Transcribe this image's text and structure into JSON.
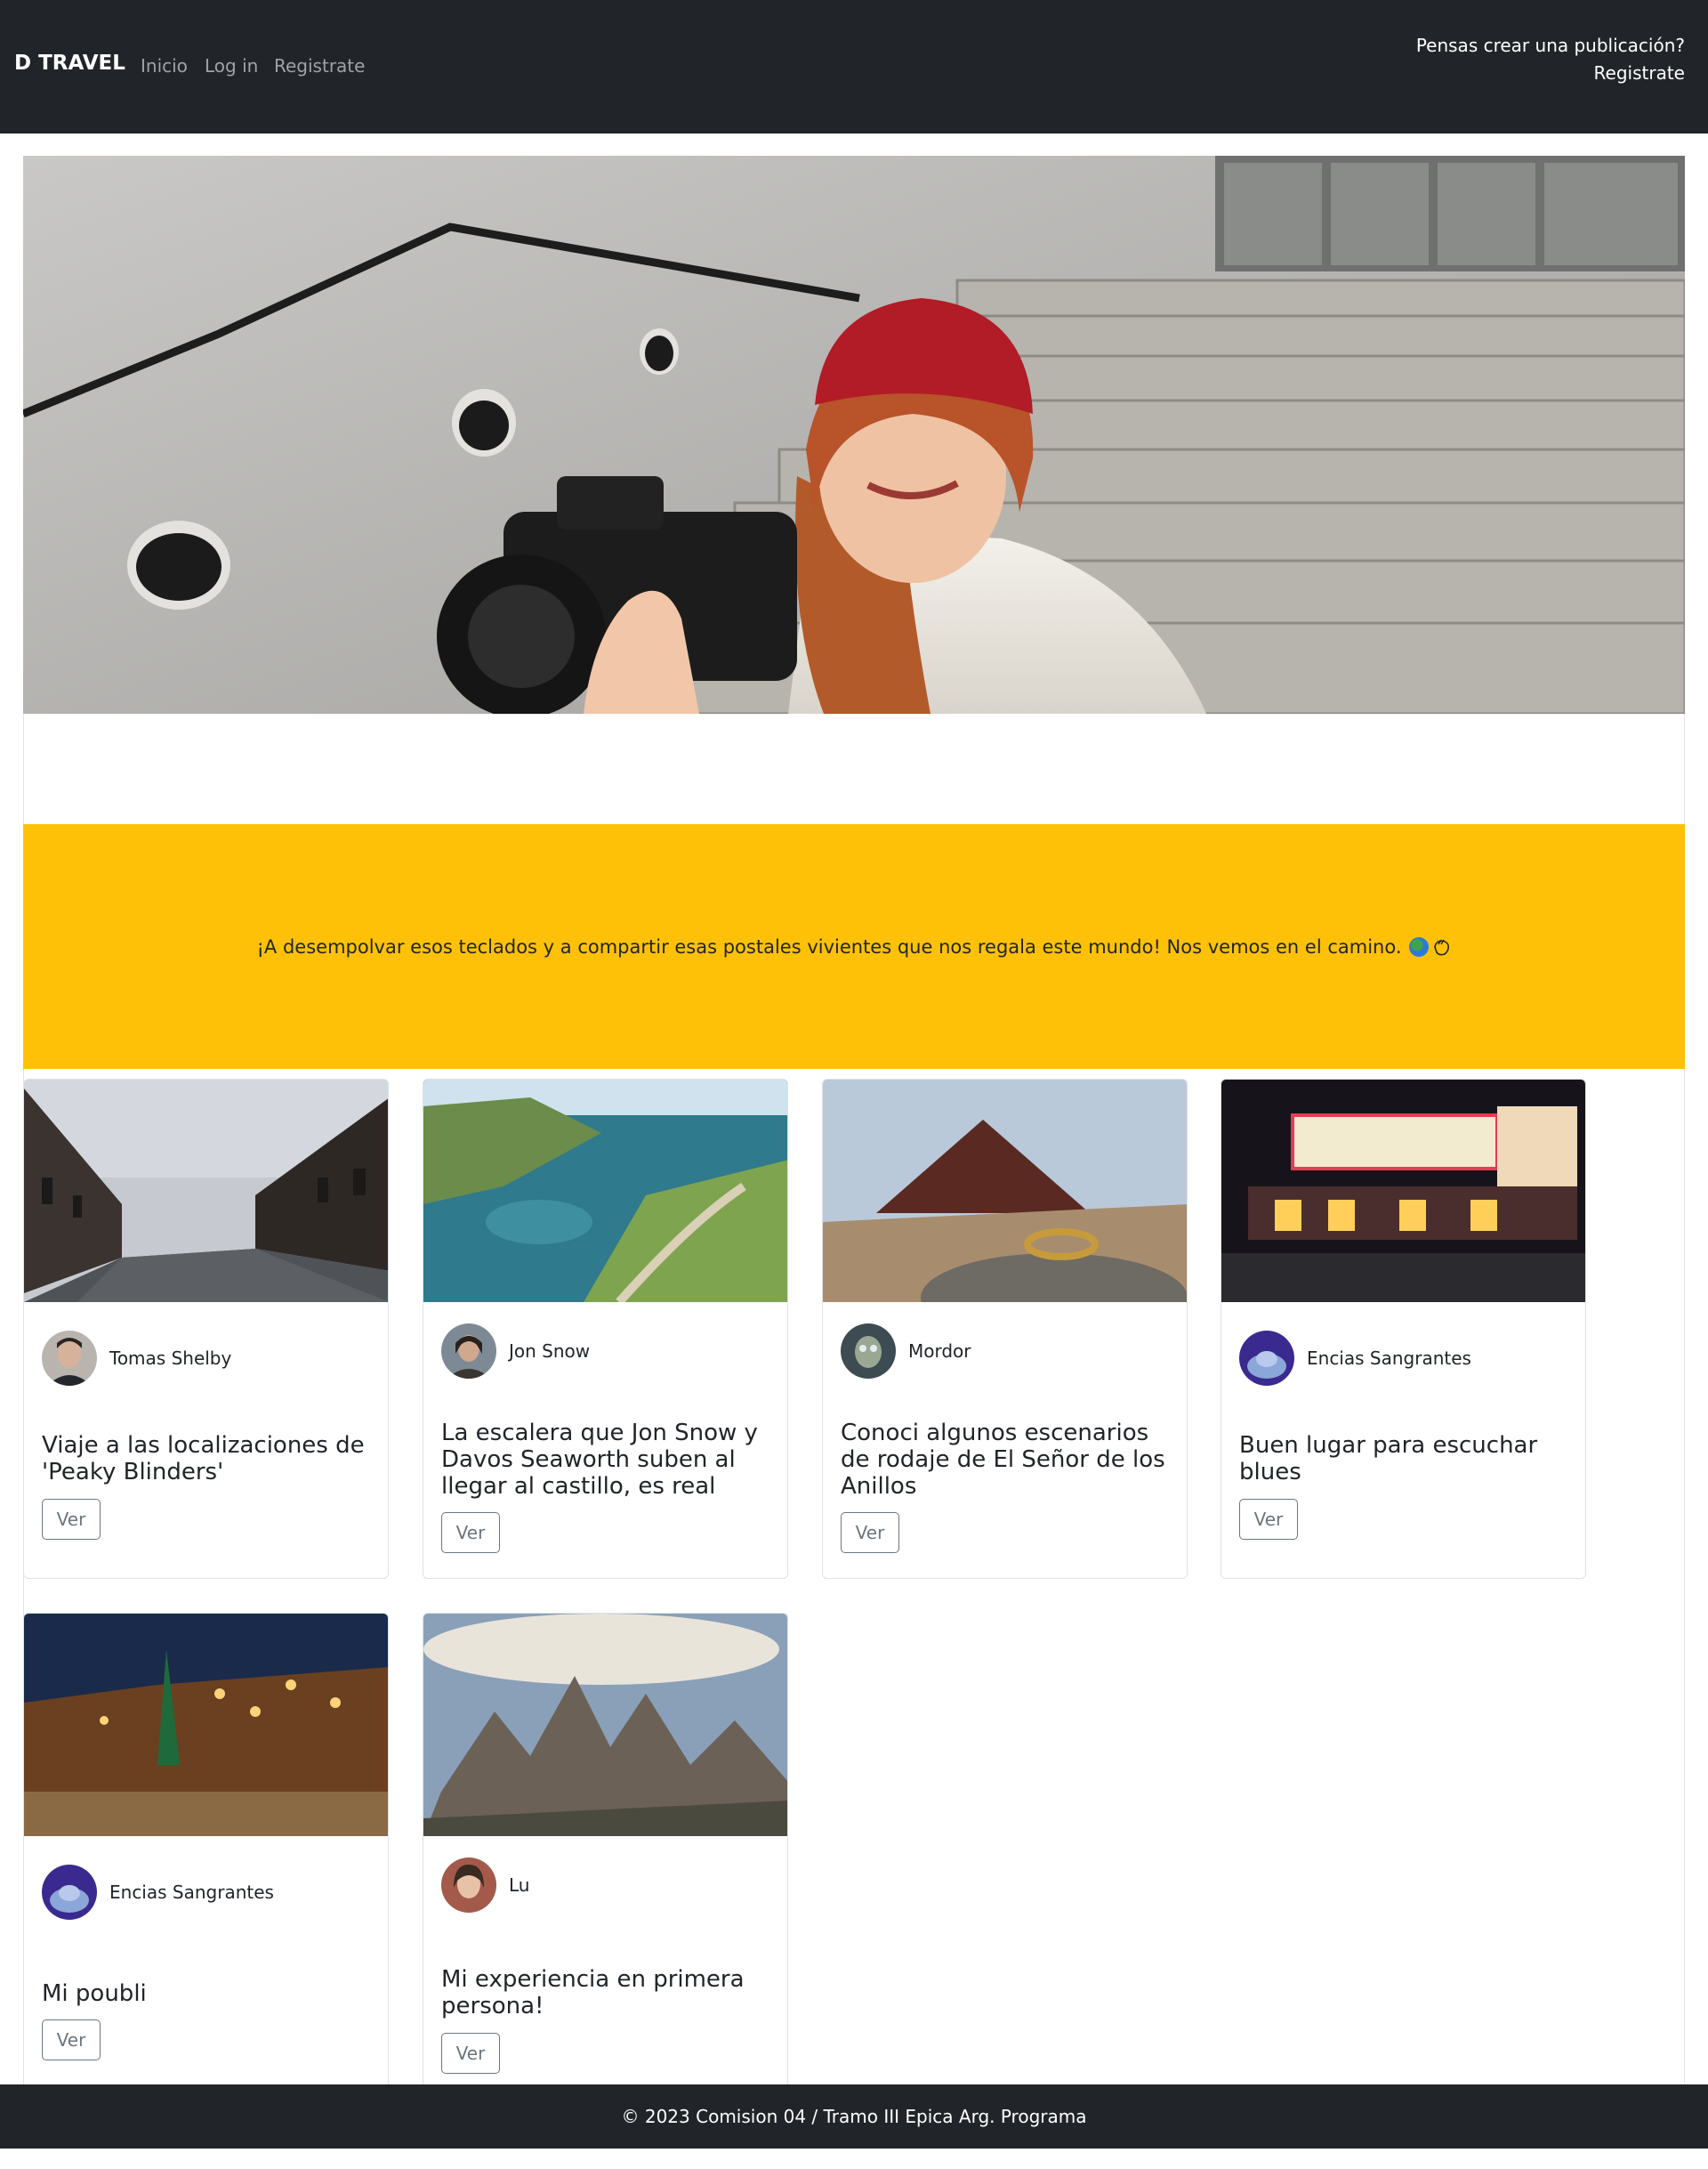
{
  "nav": {
    "brand": "D TRAVEL",
    "links": [
      "Inicio",
      "Log in",
      "Registrate"
    ],
    "cta_question": "Pensas crear una publicación?",
    "cta_link": "Registrate"
  },
  "banner": {
    "text": "¡A desempolvar esos teclados y a compartir esas postales vivientes que nos regala este mundo! Nos vemos en el camino.",
    "icons": [
      "globe-icon",
      "waving-hand-icon"
    ]
  },
  "posts": [
    {
      "author": "Tomas Shelby",
      "title": "Viaje a las localizaciones de 'Peaky Blinders'",
      "button": "Ver"
    },
    {
      "author": "Jon Snow",
      "title": "La escalera que Jon Snow y Davos Seaworth suben al llegar al castillo, es real",
      "button": "Ver"
    },
    {
      "author": "Mordor",
      "title": "Conoci algunos escenarios de rodaje de El Señor de los Anillos",
      "button": "Ver"
    },
    {
      "author": "Encias Sangrantes",
      "title": "Buen lugar para escuchar blues",
      "button": "Ver"
    },
    {
      "author": "Encias Sangrantes",
      "title": "Mi poubli",
      "button": "Ver"
    },
    {
      "author": "Lu",
      "title": "Mi experiencia en primera persona!",
      "button": "Ver"
    }
  ],
  "footer": {
    "text": "© 2023 Comision 04 / Tramo III Epica Arg. Programa"
  },
  "colors": {
    "navbar": "#212529",
    "banner": "#ffc107",
    "button_border": "#6c757d"
  }
}
